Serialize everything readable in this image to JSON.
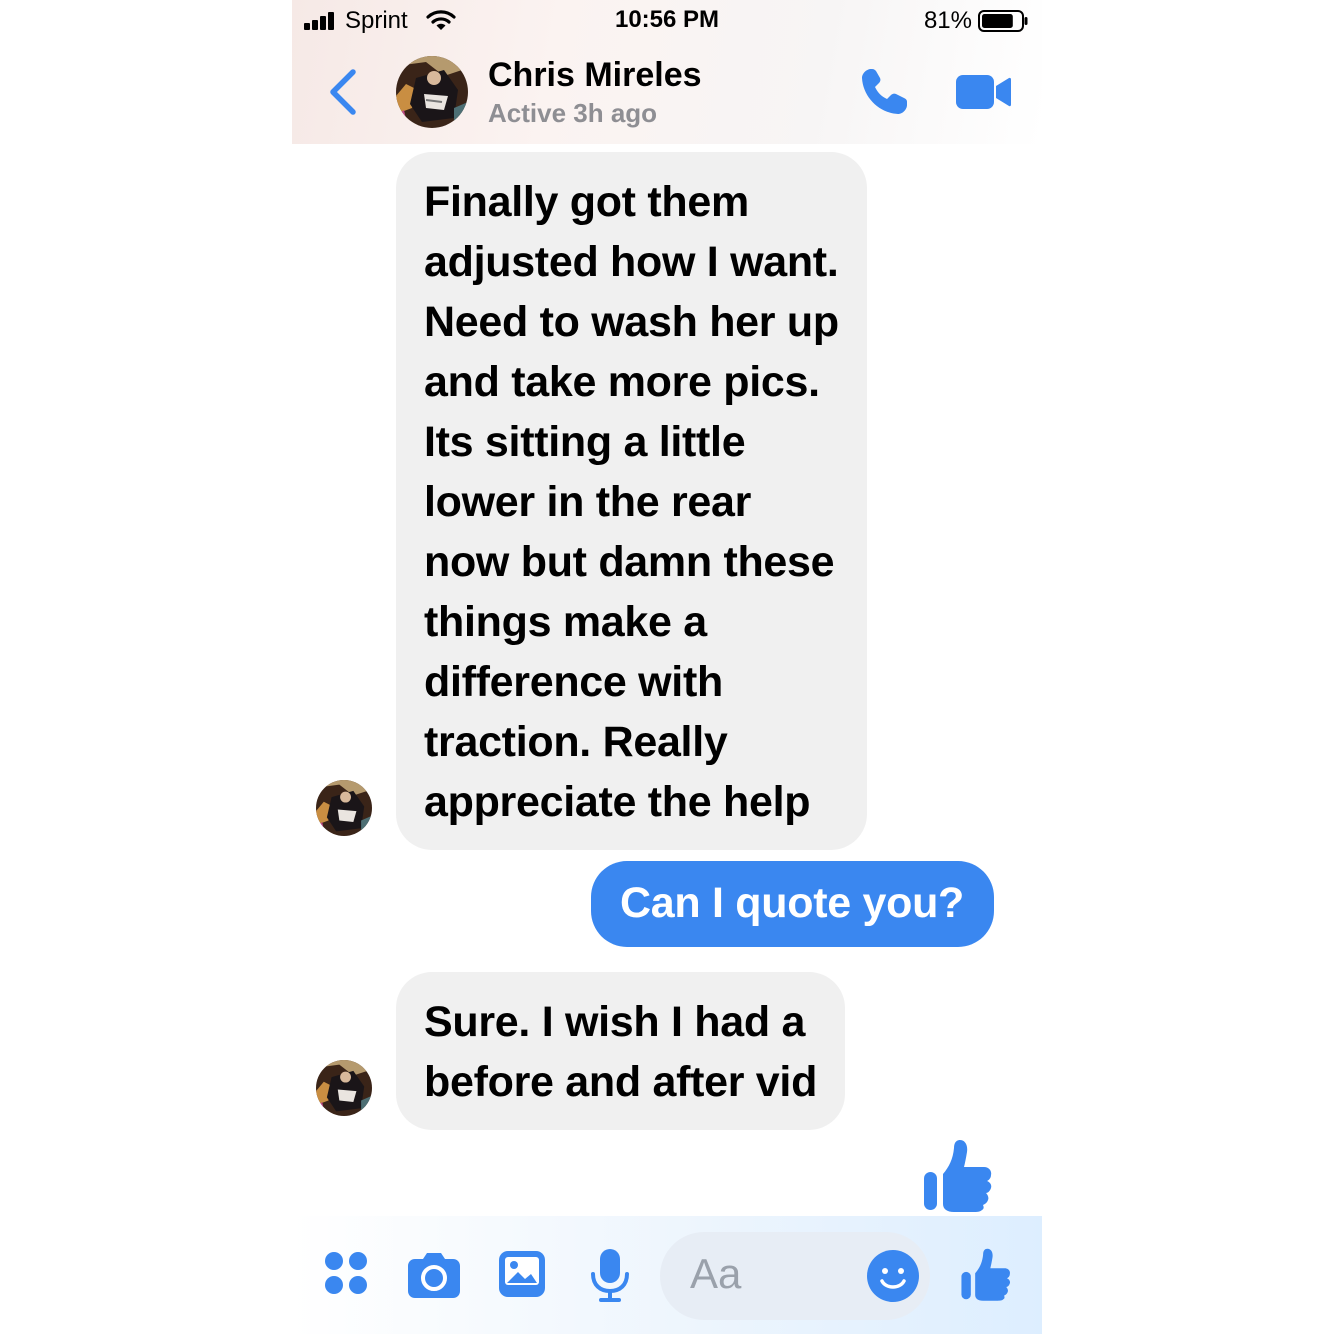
{
  "status_bar": {
    "carrier": "Sprint",
    "time": "10:56 PM",
    "battery_percent": "81%",
    "battery_level": 0.81,
    "signal_bars": 4
  },
  "header": {
    "contact_name": "Chris Mireles",
    "active_status": "Active 3h ago",
    "back_icon": "chevron-left-icon",
    "call_icon": "phone-icon",
    "video_icon": "video-camera-icon"
  },
  "messages": [
    {
      "direction": "incoming",
      "lines": [
        "Finally got them",
        "adjusted how I want.",
        "Need to wash her up",
        "and take more pics.",
        "Its sitting a little",
        "lower in the rear",
        "now but damn these",
        "things make a",
        "difference with",
        "traction. Really",
        "appreciate the help"
      ]
    },
    {
      "direction": "outgoing",
      "lines": [
        "Can I quote you?"
      ]
    },
    {
      "direction": "incoming",
      "lines": [
        "Sure. I wish I had a",
        "before and after vid"
      ]
    },
    {
      "direction": "outgoing",
      "type": "like",
      "icon": "thumbs-up-icon"
    }
  ],
  "composer": {
    "placeholder": "Aa",
    "icons": [
      "apps-grid-icon",
      "camera-icon",
      "photo-gallery-icon",
      "microphone-icon",
      "emoji-icon",
      "thumbs-up-icon"
    ]
  },
  "colors": {
    "accent": "#3a87f0",
    "incoming_bubble": "#f0f0f0",
    "outgoing_bubble": "#3a87f0",
    "secondary_text": "#8e8e93"
  }
}
